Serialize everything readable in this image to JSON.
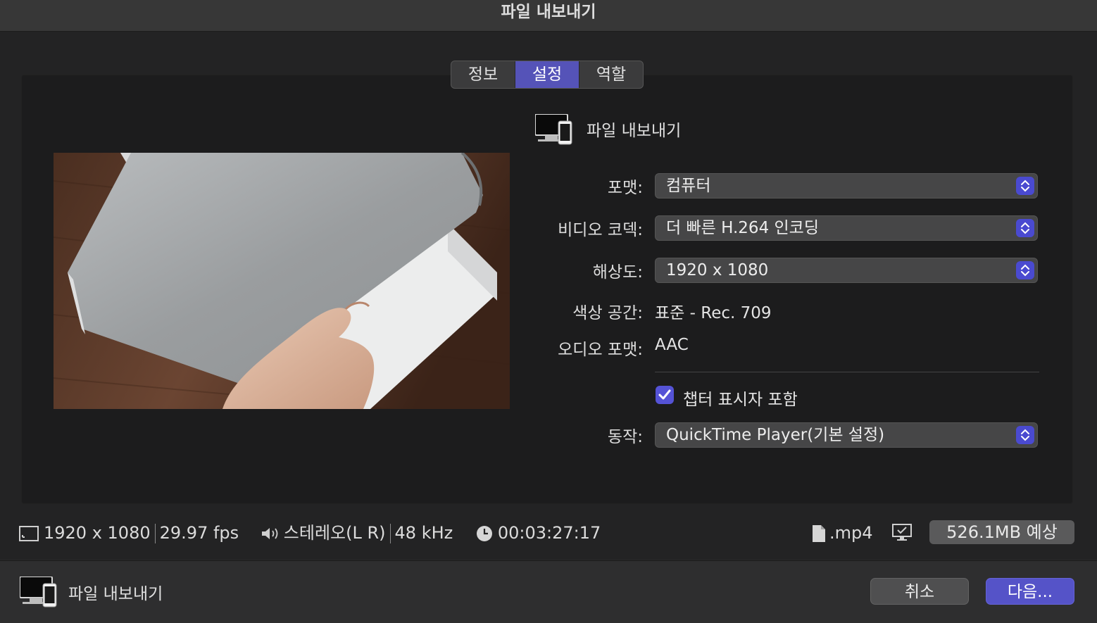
{
  "window": {
    "title": "파일 내보내기"
  },
  "tabs": [
    {
      "label": "정보",
      "active": false
    },
    {
      "label": "설정",
      "active": true
    },
    {
      "label": "역할",
      "active": false
    }
  ],
  "destination": {
    "title": "파일 내보내기",
    "icon": "computer-device-icon"
  },
  "settings": {
    "format_label": "포맷:",
    "format_value": "컴퓨터",
    "codec_label": "비디오 코덱:",
    "codec_value": "더 빠른 H.264 인코딩",
    "resolution_label": "해상도:",
    "resolution_value": "1920 x 1080",
    "colorspace_label": "색상 공간:",
    "colorspace_value": "표준 - Rec. 709",
    "audio_label": "오디오 포맷:",
    "audio_value": "AAC",
    "chapter_label": "챕터 표시자 포함",
    "chapter_checked": true,
    "action_label": "동작:",
    "action_value": "QuickTime Player(기본 설정)"
  },
  "info": {
    "resolution": "1920 x 1080",
    "fps": "29.97 fps",
    "audio_channels": "스테레오(L R)",
    "sample_rate": "48 kHz",
    "duration": "00:03:27:17",
    "extension": ".mp4",
    "size": "526.1MB 예상"
  },
  "footer": {
    "destination_label": "파일 내보내기",
    "cancel_label": "취소",
    "next_label": "다음..."
  },
  "colors": {
    "accent": "#5553c8",
    "panel": "#1c1c1d",
    "background": "#232324"
  }
}
